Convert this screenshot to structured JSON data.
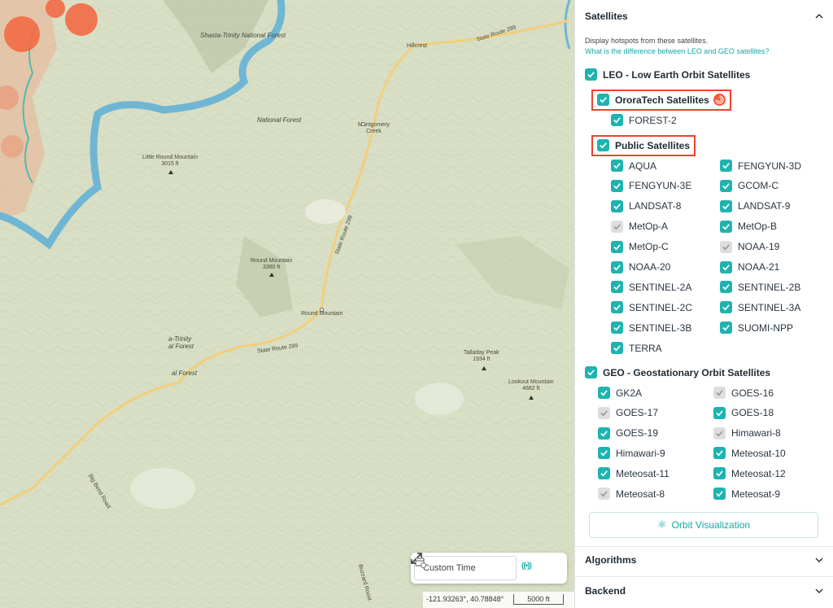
{
  "map": {
    "labels": {
      "shasta_trinity": "Shasta-Trinity\nNational Forest",
      "hillcrest": "Hillcrest",
      "state_route_299_top": "State Route 299",
      "national_forest": "National Forest",
      "montgomery_creek": "Montgomery\nCreek",
      "little_round_mountain": "Little Round Mountain\n3015 ft",
      "state_route_299_mid": "State Route 299",
      "round_mountain_peak": "Round Mountain\n3380 ft",
      "round_mountain_town": "Round Mountain",
      "trinity_forest": "a-Trinity\nal Forest",
      "al_forest": "al Forest",
      "state_route_299_low": "State Route 299",
      "talladay_peak": "Talladay Peak\n1934 ft",
      "lookout_mountain": "Lookout Mountain\n4682 ft",
      "road_bottom_left": "Big Bend Road",
      "road_bottom": "Buzzard Roost"
    },
    "controls": {
      "custom_time": "Custom Time",
      "calendar_icon": "calendar-clock-icon",
      "live_icon": "live-broadcast-icon",
      "live_glyph": "((•))",
      "expand_icon": "expand-icon"
    },
    "coords": "-121.93263°, 40.78848°",
    "scale": "5000 ft",
    "colors": {
      "hotspot": "#f26a44",
      "river": "#6fb6d4",
      "road": "#f2cf7c"
    }
  },
  "panel": {
    "satellites": {
      "title": "Satellites",
      "description": "Display hotspots from these satellites.",
      "link": "What is the difference between LEO and GEO satellites?",
      "leo": {
        "label": "LEO - Low Earth Orbit Satellites",
        "checked": true,
        "ororatech": {
          "label": "OroraTech Satellites",
          "checked": true,
          "items": [
            {
              "label": "FOREST-2",
              "checked": true
            }
          ]
        },
        "public": {
          "label": "Public Satellites",
          "checked": true,
          "items": [
            {
              "label": "AQUA",
              "checked": true
            },
            {
              "label": "FENGYUN-3D",
              "checked": true
            },
            {
              "label": "FENGYUN-3E",
              "checked": true
            },
            {
              "label": "GCOM-C",
              "checked": true
            },
            {
              "label": "LANDSAT-8",
              "checked": true
            },
            {
              "label": "LANDSAT-9",
              "checked": true
            },
            {
              "label": "MetOp-A",
              "checked": false
            },
            {
              "label": "MetOp-B",
              "checked": true
            },
            {
              "label": "MetOp-C",
              "checked": true
            },
            {
              "label": "NOAA-19",
              "checked": false
            },
            {
              "label": "NOAA-20",
              "checked": true
            },
            {
              "label": "NOAA-21",
              "checked": true
            },
            {
              "label": "SENTINEL-2A",
              "checked": true
            },
            {
              "label": "SENTINEL-2B",
              "checked": true
            },
            {
              "label": "SENTINEL-2C",
              "checked": true
            },
            {
              "label": "SENTINEL-3A",
              "checked": true
            },
            {
              "label": "SENTINEL-3B",
              "checked": true
            },
            {
              "label": "SUOMI-NPP",
              "checked": true
            },
            {
              "label": "TERRA",
              "checked": true
            }
          ]
        }
      },
      "geo": {
        "label": "GEO - Geostationary Orbit Satellites",
        "checked": true,
        "items": [
          {
            "label": "GK2A",
            "checked": true
          },
          {
            "label": "GOES-16",
            "checked": false
          },
          {
            "label": "GOES-17",
            "checked": false
          },
          {
            "label": "GOES-18",
            "checked": true
          },
          {
            "label": "GOES-19",
            "checked": true
          },
          {
            "label": "Himawari-8",
            "checked": false
          },
          {
            "label": "Himawari-9",
            "checked": true
          },
          {
            "label": "Meteosat-10",
            "checked": true
          },
          {
            "label": "Meteosat-11",
            "checked": true
          },
          {
            "label": "Meteosat-12",
            "checked": true
          },
          {
            "label": "Meteosat-8",
            "checked": false
          },
          {
            "label": "Meteosat-9",
            "checked": true
          }
        ]
      },
      "orbit_button": "Orbit Visualization",
      "orbit_icon": "orbit-icon"
    },
    "algorithms": {
      "title": "Algorithms"
    },
    "backend": {
      "title": "Backend"
    },
    "colors": {
      "accent": "#1fb3b0",
      "highlight": "#e8452c",
      "unchecked": "#dedede"
    }
  }
}
